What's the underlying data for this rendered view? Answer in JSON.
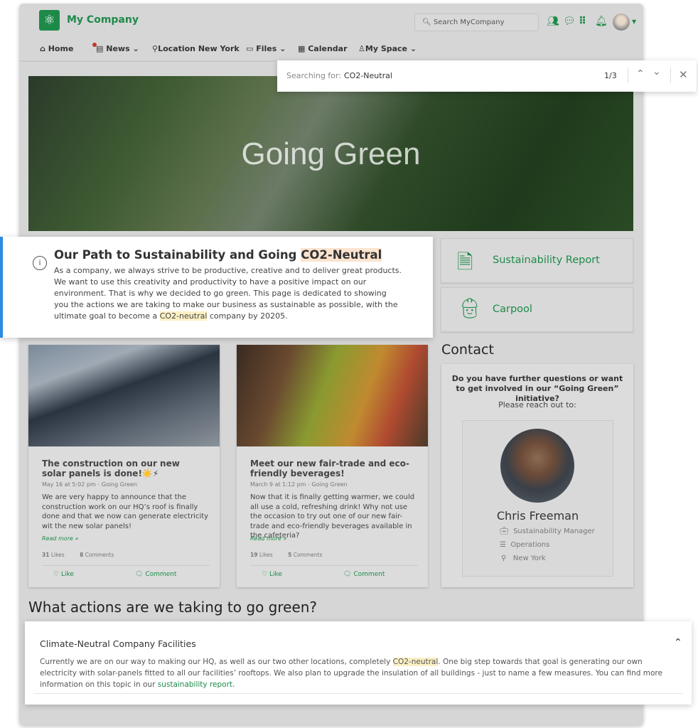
{
  "header": {
    "brand": "My Company",
    "search_placeholder": "Search MyCompany",
    "icons": [
      "people-icon",
      "chat-icon",
      "apps-grid-icon",
      "bell-icon",
      "avatar"
    ]
  },
  "nav": [
    {
      "label": "Home",
      "icon": "home-icon"
    },
    {
      "label": "News",
      "icon": "news-icon",
      "badge": true
    },
    {
      "label": "Location New York",
      "icon": "location-icon"
    },
    {
      "label": "Files",
      "icon": "folder-icon"
    },
    {
      "label": "Calendar",
      "icon": "calendar-icon"
    },
    {
      "label": "My Space",
      "icon": "user-icon"
    }
  ],
  "find": {
    "label": "Searching for:",
    "query": "CO2-Neutral",
    "count": "1/3"
  },
  "hero": {
    "title": "Going Green"
  },
  "info": {
    "title_pre": "Our Path to Sustainability and Going ",
    "title_hl": "CO2-Neutral",
    "body_pre": "As a company, we always strive to be productive, creative and to deliver great products. We want to use this creativity and productivity to have a positive impact on our environment. That is why we decided to go green. This page is dedicated to showing you the actions we are taking to make our business as sustainable as possible, with the ultimate goal to become a ",
    "body_hl": "CO2-neutral",
    "body_post": " company by 20205."
  },
  "tiles": [
    {
      "label": "Sustainability Report",
      "icon": "document-icon"
    },
    {
      "label": "Carpool",
      "icon": "carpool-icon"
    }
  ],
  "news": [
    {
      "title": "The construction on our new solar panels is done!☀️⚡",
      "meta": "May 16 at 5:02 pm - Going Green",
      "body": "We are very happy to announce that the construction work on our HQ’s roof is finally done and that we now can generate electricity wit the new solar panels!",
      "more": "Read more »",
      "likes": "31",
      "likes_label": "Likes",
      "comments": "8",
      "comments_label": "Comments",
      "like": "Like",
      "comment": "Comment"
    },
    {
      "title": "Meet our new fair-trade and eco-friendly beverages!",
      "meta": "March 9 at 1:12 pm - Going Green",
      "body": "Now that it is finally getting warmer, we could all use a cold, refreshing drink! Why not use the occasion to try out one of our new fair-trade and eco-friendly beverages available in the cafeteria?",
      "more": "Read more »",
      "likes": "19",
      "likes_label": "Likes",
      "comments": "5",
      "comments_label": "Comments",
      "like": "Like",
      "comment": "Comment"
    }
  ],
  "contact": {
    "heading": "Contact",
    "question": "Do you have further questions or want to get involved in our “Going Green” initiative?",
    "reach": "Please reach out to:",
    "name": "Chris Freeman",
    "role": "Sustainability Manager",
    "department": "Operations",
    "location": "New York"
  },
  "section": {
    "heading": "What actions are we taking to go green?"
  },
  "accordion": {
    "title": "Climate-Neutral Company Facilities",
    "pre": "Currently we are on our way to making our HQ, as well as our two other locations, completely ",
    "hl": "CO2-neutral",
    "mid": ". One big step towards that goal is  generating our own electricity with solar-panels fitted to all our facilities’ rooftops. We also plan to upgrade the insulation of all buildings - just to name a few measures. You can find more information on this topic in our ",
    "link": "sustainability report",
    "post": "."
  },
  "colors": {
    "accent": "#1e8a4a",
    "info_border": "#2a8be0",
    "highlight": "#fbe3cf"
  }
}
